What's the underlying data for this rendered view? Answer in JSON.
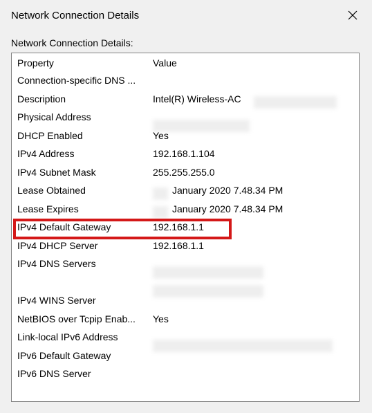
{
  "window": {
    "title": "Network Connection Details"
  },
  "content": {
    "list_label": "Network Connection Details:",
    "header_property": "Property",
    "header_value": "Value"
  },
  "rows": [
    {
      "property": "Connection-specific DNS ...",
      "value": ""
    },
    {
      "property": "Description",
      "value": "Intel(R) Wireless-AC"
    },
    {
      "property": "Physical Address",
      "value": ""
    },
    {
      "property": "DHCP Enabled",
      "value": "Yes"
    },
    {
      "property": "IPv4 Address",
      "value": "192.168.1.104"
    },
    {
      "property": "IPv4 Subnet Mask",
      "value": "255.255.255.0"
    },
    {
      "property": "Lease Obtained",
      "value": "January 2020 7.48.34 PM"
    },
    {
      "property": "Lease Expires",
      "value": "January 2020 7.48.34 PM"
    },
    {
      "property": "IPv4 Default Gateway",
      "value": "192.168.1.1"
    },
    {
      "property": "IPv4 DHCP Server",
      "value": "192.168.1.1"
    },
    {
      "property": "IPv4 DNS Servers",
      "value": ""
    },
    {
      "property": "",
      "value": ""
    },
    {
      "property": "IPv4 WINS Server",
      "value": ""
    },
    {
      "property": "NetBIOS over Tcpip Enab...",
      "value": "Yes"
    },
    {
      "property": "Link-local IPv6 Address",
      "value": ""
    },
    {
      "property": "IPv6 Default Gateway",
      "value": ""
    },
    {
      "property": "IPv6 DNS Server",
      "value": ""
    }
  ]
}
